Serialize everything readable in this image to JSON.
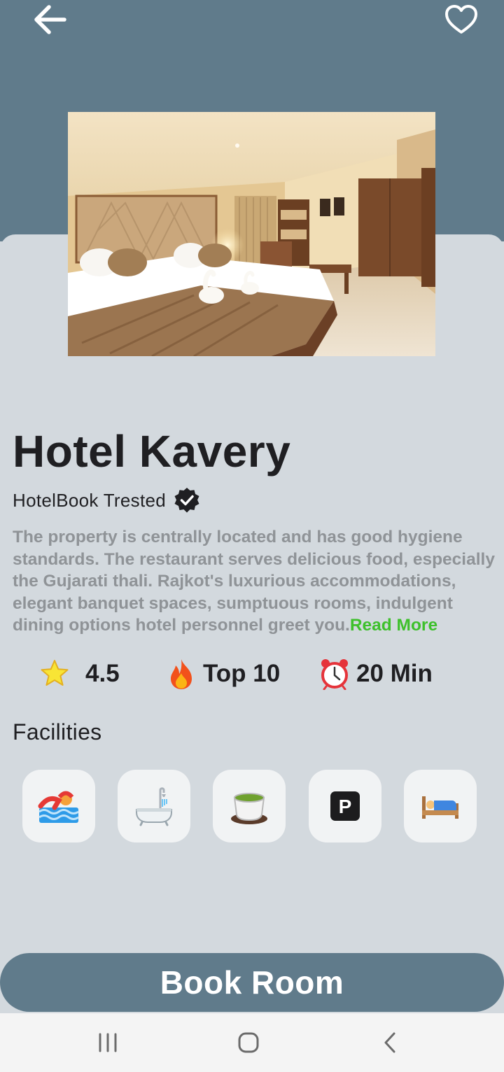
{
  "hotel": {
    "name": "Hotel Kavery",
    "trusted_label": "HotelBook Trested",
    "description": "The property is centrally located and has good hygiene standards. The restaurant serves delicious food, especially the Gujarati thali. Rajkot's luxurious accommodations, elegant banquet spaces, sumptuous rooms, indulgent dining options hotel personnel greet you.",
    "read_more": "Read More"
  },
  "stats": {
    "rating": "4.5",
    "rank": "Top 10",
    "time": "20 Min"
  },
  "facilities": {
    "title": "Facilities",
    "items": [
      "swimming-icon",
      "bathtub-icon",
      "tea-icon",
      "parking-icon",
      "bed-icon"
    ]
  },
  "actions": {
    "book_label": "Book Room"
  },
  "colors": {
    "primary": "#607b8b",
    "background": "#d3d9de",
    "link": "#3ec02c",
    "muted_text": "#8f9397"
  }
}
